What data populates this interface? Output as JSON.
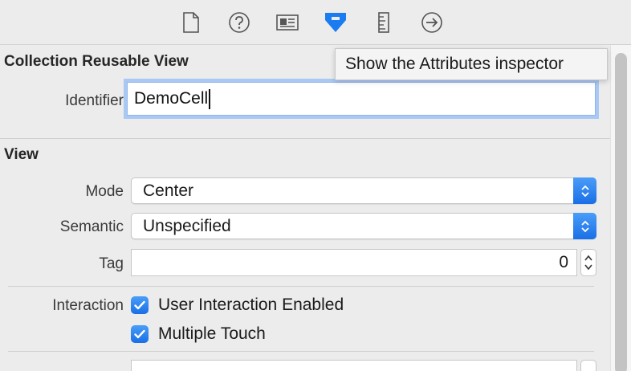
{
  "toolbar": {
    "tabs": [
      {
        "icon": "file-icon",
        "label": "File inspector"
      },
      {
        "icon": "help-icon",
        "label": "Quick Help inspector"
      },
      {
        "icon": "identity-icon",
        "label": "Identity inspector"
      },
      {
        "icon": "attributes-icon",
        "label": "Attributes inspector",
        "selected": true
      },
      {
        "icon": "size-icon",
        "label": "Size inspector"
      },
      {
        "icon": "connections-icon",
        "label": "Connections inspector"
      }
    ],
    "accent_color": "#1a7cf0"
  },
  "tooltip": {
    "text": "Show the Attributes inspector"
  },
  "reusable_view": {
    "title": "Collection Reusable View",
    "identifier_label": "Identifier",
    "identifier_value": "DemoCell"
  },
  "view": {
    "title": "View",
    "mode_label": "Mode",
    "mode_value": "Center",
    "semantic_label": "Semantic",
    "semantic_value": "Unspecified",
    "tag_label": "Tag",
    "tag_value": "0",
    "interaction_label": "Interaction",
    "checkboxes": [
      {
        "label": "User Interaction Enabled",
        "checked": true
      },
      {
        "label": "Multiple Touch",
        "checked": true
      }
    ]
  }
}
